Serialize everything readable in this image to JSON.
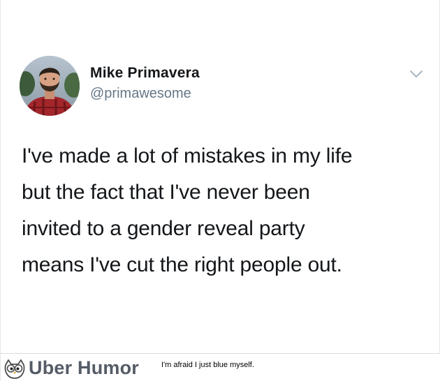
{
  "tweet": {
    "display_name": "Mike Primavera",
    "handle": "@primawesome",
    "text_lines": [
      "I've made a lot of mistakes in my life",
      "but the fact that I've never been",
      "invited to a gender reveal party",
      "means I've cut the right people out."
    ],
    "menu_icon": "chevron-down-icon",
    "avatar_icon": "profile-photo"
  },
  "footer": {
    "brand": "Uber Humor",
    "caption": "I'm afraid I just blue myself.",
    "logo_icon": "owl-icon"
  },
  "colors": {
    "name": "#14171a",
    "handle": "#657786",
    "chevron": "#aab8c2",
    "brand": "#555c66"
  }
}
